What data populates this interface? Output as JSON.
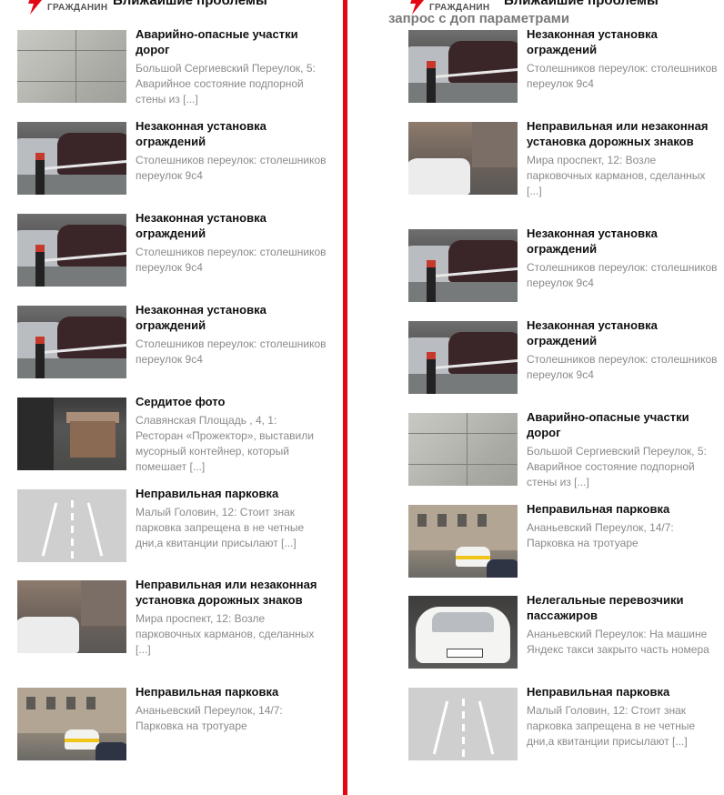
{
  "brand": {
    "logo_text": "ГРАЖДАНИН"
  },
  "left": {
    "heading": "Ближайшие проблемы",
    "items": [
      {
        "title": "Аварийно-опасные участки дорог",
        "text": "Большой Сергиевский Переулок, 5: Аварийное состояние подпорной стены из [...]",
        "thumb": "crack-wall-photo"
      },
      {
        "title": "Незаконная установка ограждений",
        "text": "Столешников переулок: столешников переулок 9с4",
        "thumb": "barrier-photo"
      },
      {
        "title": "Незаконная установка ограждений",
        "text": "Столешников переулок: столешников переулок 9с4",
        "thumb": "barrier-photo"
      },
      {
        "title": "Незаконная установка ограждений",
        "text": "Столешников переулок: столешников переулок 9с4",
        "thumb": "barrier-photo"
      },
      {
        "title": "Сердитое фото",
        "text": "Славянская Площадь , 4, 1: Ресторан «Прожектор», выставили мусорный контейнер, который помешает [...]",
        "thumb": "trash-container-photo"
      },
      {
        "title": "Неправильная парковка",
        "text": "Малый Головин, 12: Стоит знак парковка запрещена в не четные дни,а квитанции присылают [...]",
        "thumb": "road-placeholder"
      },
      {
        "title": "Неправильная или незаконная установка дорожных знаков",
        "text": "Мира проспект, 12: Возле парковочных карманов, сделанных [...]",
        "thumb": "street-car-photo"
      },
      {
        "title": "Неправильная парковка",
        "text": "Ананьевский Переулок, 14/7: Парковка на тротуаре",
        "thumb": "yellow-taxi-photo"
      }
    ]
  },
  "right": {
    "heading": "Ближайшие проблемы",
    "subheading": "запрос с доп параметрами",
    "items": [
      {
        "title": "Незаконная установка ограждений",
        "text": "Столешников переулок: столешников переулок 9с4",
        "thumb": "barrier-photo"
      },
      {
        "title": "Неправильная или незаконная установка дорожных знаков",
        "text": "Мира проспект, 12: Возле парковочных карманов, сделанных [...]",
        "thumb": "street-car-photo"
      },
      {
        "title": "Незаконная установка ограждений",
        "text": "Столешников переулок: столешников переулок 9с4",
        "thumb": "barrier-photo"
      },
      {
        "title": "Незаконная установка ограждений",
        "text": "Столешников переулок: столешников переулок 9с4",
        "thumb": "barrier-photo"
      },
      {
        "title": "Аварийно-опасные участки дорог",
        "text": "Большой Сергиевский Переулок, 5: Аварийное состояние подпорной стены из [...]",
        "thumb": "crack-wall-photo"
      },
      {
        "title": "Неправильная парковка",
        "text": "Ананьевский Переулок, 14/7: Парковка на тротуаре",
        "thumb": "yellow-taxi-photo"
      },
      {
        "title": "Нелегальные перевозчики пассажиров",
        "text": "Ананьевский Переулок: На машине Яндекс такси закрыто часть номера",
        "thumb": "taxi-front-photo"
      },
      {
        "title": "Неправильная парковка",
        "text": "Малый Головин, 12: Стоит знак парковка запрещена в не четные дни,а квитанции присылают [...]",
        "thumb": "road-placeholder"
      }
    ]
  },
  "colors": {
    "divider": "#e30613",
    "title": "#111111",
    "text": "#8a8a8a"
  }
}
